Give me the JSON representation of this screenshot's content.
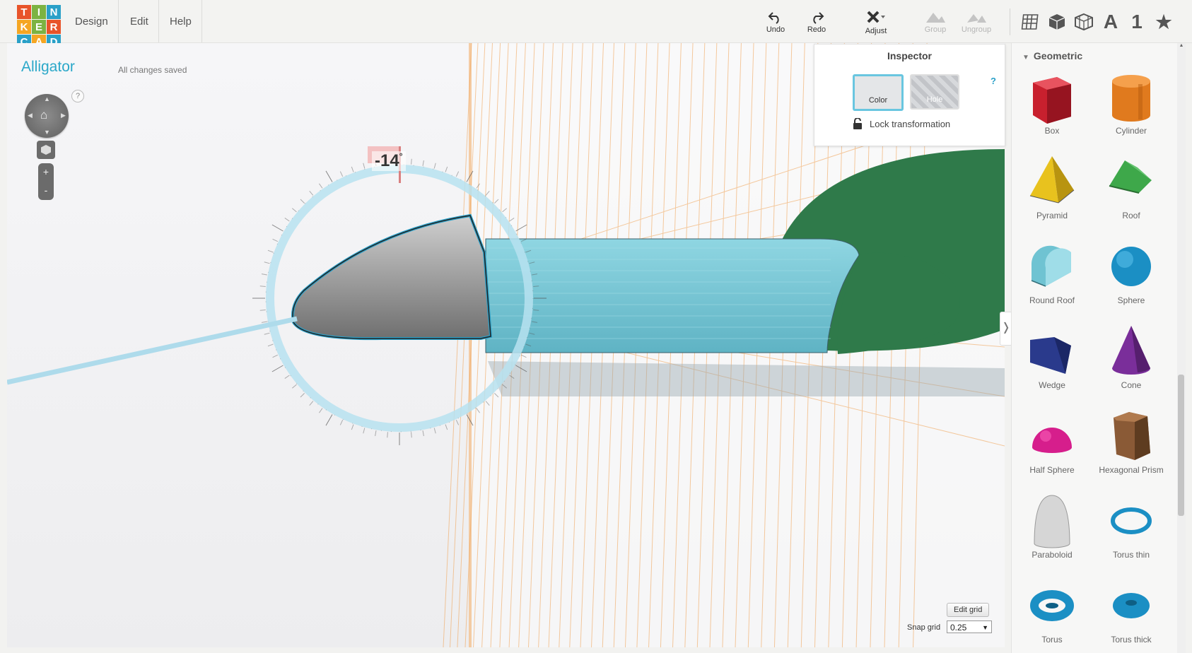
{
  "logo": {
    "letters": [
      "T",
      "I",
      "N",
      "K",
      "E",
      "R",
      "C",
      "A",
      "D"
    ],
    "colors": [
      "#e8542a",
      "#7cb342",
      "#2aa0c8",
      "#f5a623",
      "#7cb342",
      "#e8542a",
      "#2aa0c8",
      "#f5a623",
      "#2aa0c8"
    ]
  },
  "menu": {
    "design": "Design",
    "edit": "Edit",
    "help": "Help"
  },
  "toolbar": {
    "undo": "Undo",
    "redo": "Redo",
    "adjust": "Adjust",
    "group": "Group",
    "ungroup": "Ungroup"
  },
  "views": {
    "font_label": "A",
    "number_label": "1"
  },
  "project": {
    "title": "Alligator",
    "status": "All changes saved"
  },
  "nav": {
    "help": "?",
    "zoom_in": "+",
    "zoom_out": "-"
  },
  "rotation": {
    "value": "-14",
    "unit": "°"
  },
  "inspector": {
    "title": "Inspector",
    "help": "?",
    "color_label": "Color",
    "hole_label": "Hole",
    "lock_label": "Lock transformation"
  },
  "grid": {
    "edit_label": "Edit grid",
    "snap_label": "Snap grid",
    "snap_value": "0.25"
  },
  "library": {
    "category": "Geometric",
    "shapes": [
      {
        "label": "Box",
        "icon": "box-icon",
        "color": "#c8202e"
      },
      {
        "label": "Cylinder",
        "icon": "cylinder-icon",
        "color": "#e07a1e"
      },
      {
        "label": "Pyramid",
        "icon": "pyramid-icon",
        "color": "#e8c21e"
      },
      {
        "label": "Roof",
        "icon": "roof-icon",
        "color": "#3ea84a"
      },
      {
        "label": "Round Roof",
        "icon": "round-roof-icon",
        "color": "#6fc3d2"
      },
      {
        "label": "Sphere",
        "icon": "sphere-icon",
        "color": "#1b8fc4"
      },
      {
        "label": "Wedge",
        "icon": "wedge-icon",
        "color": "#2a3a8c"
      },
      {
        "label": "Cone",
        "icon": "cone-icon",
        "color": "#7a2e9a"
      },
      {
        "label": "Half Sphere",
        "icon": "half-sphere-icon",
        "color": "#d61e8c"
      },
      {
        "label": "Hexagonal Prism",
        "icon": "hexagonal-prism-icon",
        "color": "#8a5a36"
      },
      {
        "label": "Paraboloid",
        "icon": "paraboloid-icon",
        "color": "#d6d6d6"
      },
      {
        "label": "Torus thin",
        "icon": "torus-thin-icon",
        "color": "#1b8fc4"
      },
      {
        "label": "Torus",
        "icon": "torus-icon",
        "color": "#1b8fc4"
      },
      {
        "label": "Torus thick",
        "icon": "torus-thick-icon",
        "color": "#1b8fc4"
      }
    ]
  },
  "scene_colors": {
    "selected_outline": "#2aa0c8",
    "body": "#7ecfdc",
    "head": "#2f7a4a",
    "snout": "#9e9e9e",
    "grid_lines": "#f0a050"
  }
}
